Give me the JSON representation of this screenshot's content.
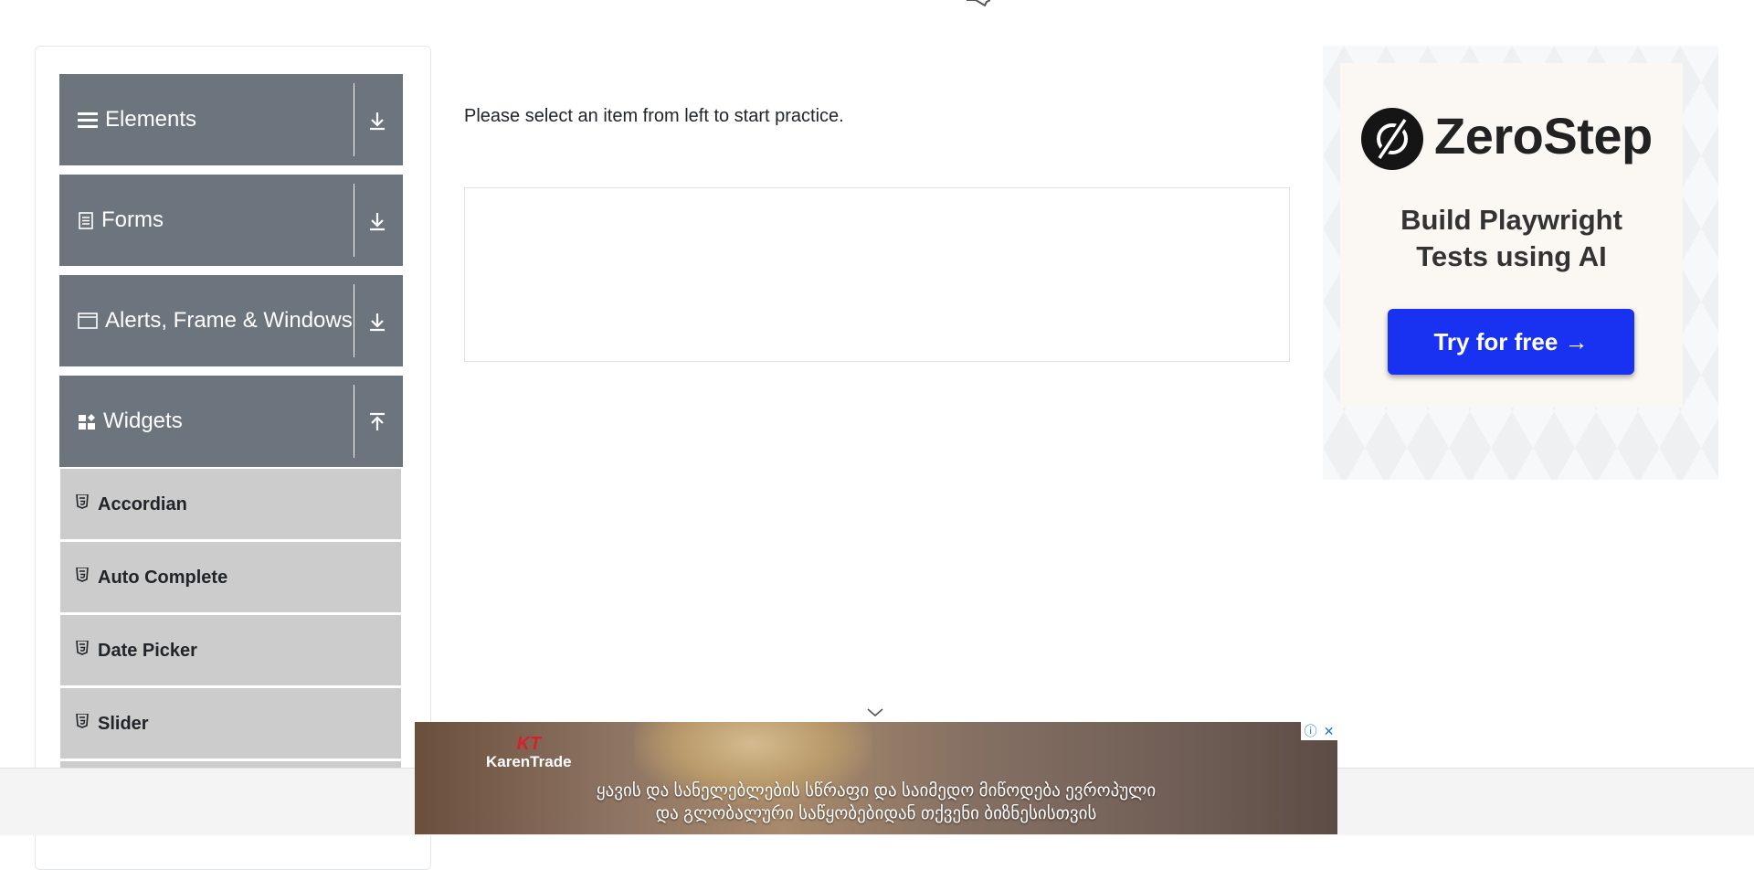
{
  "sidebar": {
    "groups": [
      {
        "label": "Elements",
        "icon": "hamburger-icon",
        "toggle_icon": "expand-down-icon"
      },
      {
        "label": "Forms",
        "icon": "document-icon",
        "toggle_icon": "expand-down-icon"
      },
      {
        "label": "Alerts, Frame & Windows",
        "icon": "window-icon",
        "toggle_icon": "expand-down-icon"
      },
      {
        "label": "Widgets",
        "icon": "widgets-icon",
        "toggle_icon": "collapse-up-icon"
      }
    ],
    "widget_items": [
      {
        "label": "Accordian",
        "icon": "html5-icon"
      },
      {
        "label": "Auto Complete",
        "icon": "html5-icon"
      },
      {
        "label": "Date Picker",
        "icon": "html5-icon"
      },
      {
        "label": "Slider",
        "icon": "html5-icon"
      }
    ]
  },
  "main": {
    "instruction": "Please select an item from left to start practice."
  },
  "ad_right": {
    "brand": "ZeroStep",
    "tagline_1": "Build Playwright",
    "tagline_2": "Tests using AI",
    "cta": "Try for free →"
  },
  "ad_bottom": {
    "logo_mark": "KT",
    "logo_name": "KarenTrade",
    "line_1": "ყავის და სანელებლების სწრაფი და საიმედო მიწოდება ევროპული",
    "line_2": "და გლობალური საწყობებიდან თქვენი ბიზნესისთვის",
    "info_icon": "ⓘ",
    "close_icon": "✕"
  },
  "colors": {
    "group_header": "#6c757d",
    "menu_item": "#cccccc",
    "cta_button": "#1931f0"
  }
}
